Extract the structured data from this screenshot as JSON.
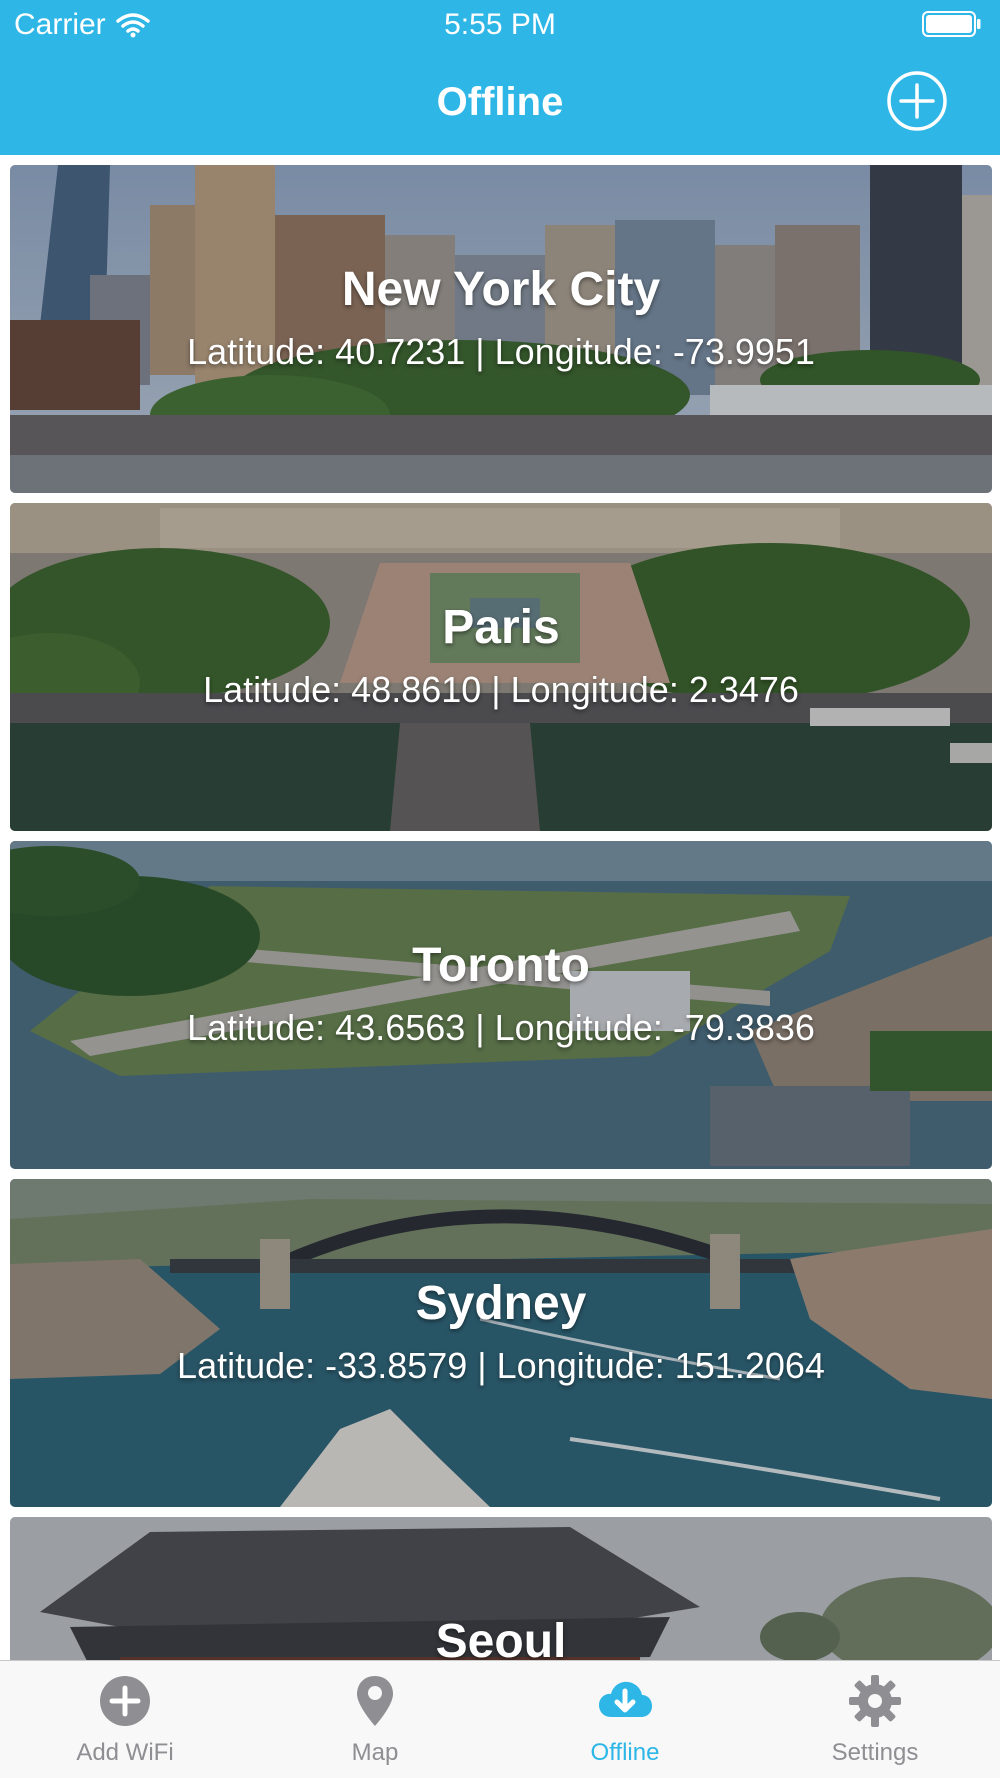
{
  "colors": {
    "accent": "#2DB6E6",
    "tab_inactive": "#8E8E93",
    "tab_bar_background": "#F8F8F8"
  },
  "status_bar": {
    "carrier": "Carrier",
    "time": "5:55 PM",
    "icons": [
      "wifi-icon",
      "battery-icon"
    ]
  },
  "nav": {
    "title": "Offline",
    "right_button_icon": "plus-circle-icon"
  },
  "locations": [
    {
      "name": "New York City",
      "coords": "Latitude: 40.7231 | Longitude: -73.9951",
      "image": "new-york-skyline-photo"
    },
    {
      "name": "Paris",
      "coords": "Latitude: 48.8610 | Longitude: 2.3476",
      "image": "paris-aerial-photo"
    },
    {
      "name": "Toronto",
      "coords": "Latitude: 43.6563 | Longitude: -79.3836",
      "image": "toronto-island-airport-photo"
    },
    {
      "name": "Sydney",
      "coords": "Latitude: -33.8579 | Longitude: 151.2064",
      "image": "sydney-harbour-photo"
    },
    {
      "name": "Seoul",
      "coords": "",
      "image": "seoul-palace-photo"
    }
  ],
  "tabs": [
    {
      "label": "Add WiFi",
      "icon": "plus-circle-icon",
      "active": false
    },
    {
      "label": "Map",
      "icon": "map-pin-icon",
      "active": false
    },
    {
      "label": "Offline",
      "icon": "cloud-download-icon",
      "active": true
    },
    {
      "label": "Settings",
      "icon": "gear-icon",
      "active": false
    }
  ]
}
